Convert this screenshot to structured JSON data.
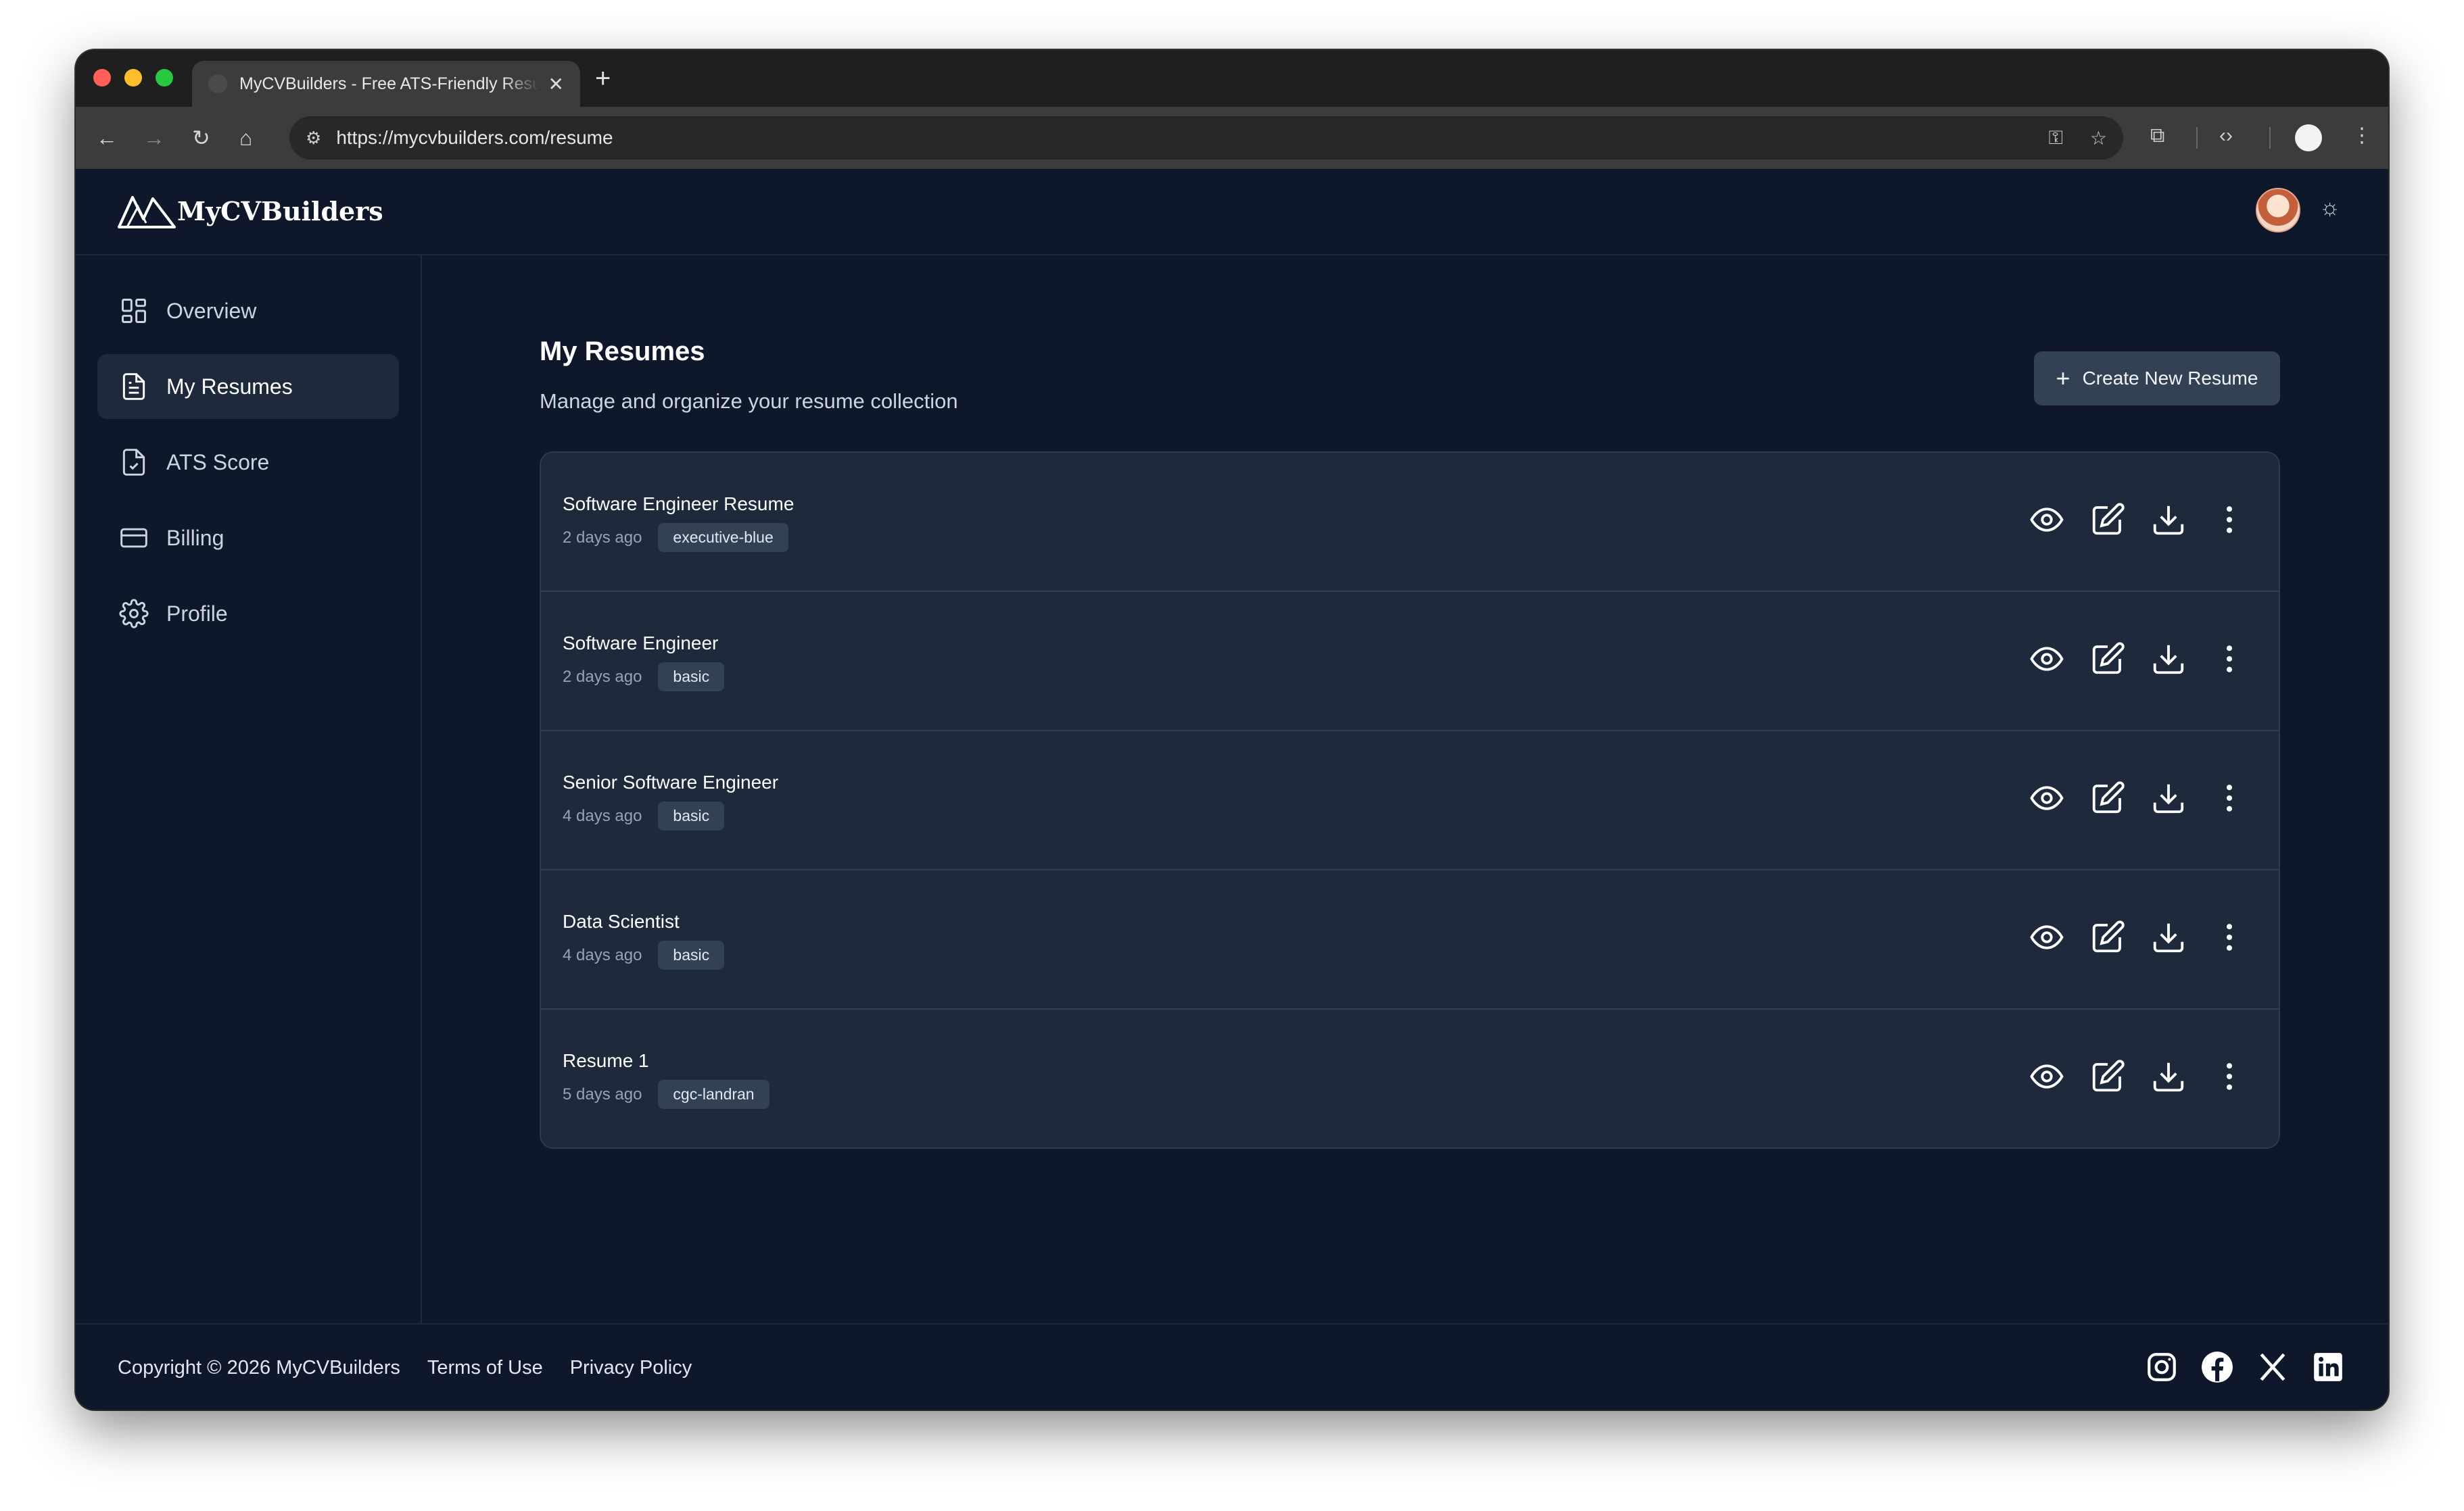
{
  "browser": {
    "tab_title": "MyCVBuilders - Free ATS-Friendly Resume Builder",
    "url": "https://mycvbuilders.com/resume"
  },
  "brand": {
    "name": "MyCVBuilders"
  },
  "sidebar": {
    "items": [
      {
        "label": "Overview",
        "icon": "dashboard-icon",
        "active": false
      },
      {
        "label": "My Resumes",
        "icon": "document-icon",
        "active": true
      },
      {
        "label": "ATS Score",
        "icon": "file-check-icon",
        "active": false
      },
      {
        "label": "Billing",
        "icon": "credit-card-icon",
        "active": false
      },
      {
        "label": "Profile",
        "icon": "gear-icon",
        "active": false
      }
    ]
  },
  "main": {
    "title": "My Resumes",
    "subtitle": "Manage and organize your resume collection",
    "create_label": "Create New Resume",
    "resumes": [
      {
        "title": "Software Engineer Resume",
        "updated": "2 days ago",
        "template": "executive-blue"
      },
      {
        "title": "Software Engineer",
        "updated": "2 days ago",
        "template": "basic"
      },
      {
        "title": "Senior Software Engineer",
        "updated": "4 days ago",
        "template": "basic"
      },
      {
        "title": "Data Scientist",
        "updated": "4 days ago",
        "template": "basic"
      },
      {
        "title": "Resume 1",
        "updated": "5 days ago",
        "template": "cgc-landran"
      }
    ]
  },
  "footer": {
    "copyright": "Copyright © 2026 MyCVBuilders",
    "terms": "Terms of Use",
    "privacy": "Privacy Policy"
  },
  "colors": {
    "background": "#0f172a",
    "panel": "#1e293b",
    "tag": "#334155",
    "text": "#ffffff",
    "muted": "#94a3b8"
  }
}
